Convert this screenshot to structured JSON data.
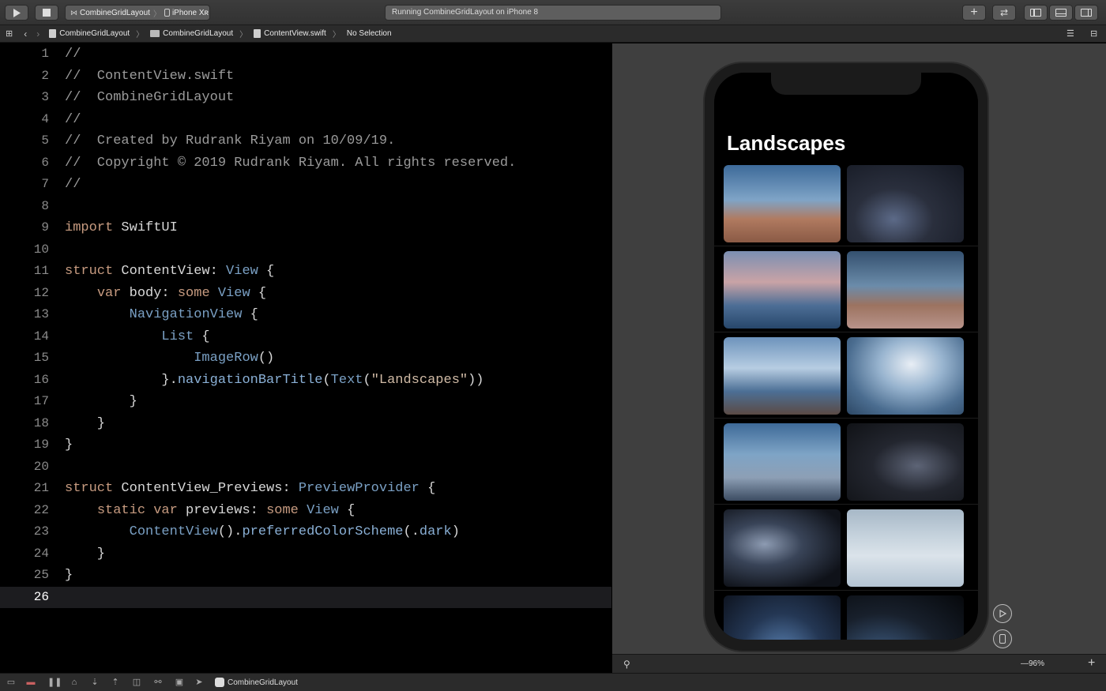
{
  "toolbar": {
    "scheme_project": "CombineGridLayout",
    "scheme_device": "iPhone Xʀ",
    "activity": "Running CombineGridLayout on iPhone 8",
    "add_label": "+",
    "swap_label": "⇄"
  },
  "jumpbar": {
    "project": "CombineGridLayout",
    "group": "CombineGridLayout",
    "file": "ContentView.swift",
    "selection": "No Selection"
  },
  "editor": {
    "current_line": 26,
    "lines": [
      "1",
      "2",
      "3",
      "4",
      "5",
      "6",
      "7",
      "8",
      "9",
      "10",
      "11",
      "12",
      "13",
      "14",
      "15",
      "16",
      "17",
      "18",
      "19",
      "20",
      "21",
      "22",
      "23",
      "24",
      "25",
      "26"
    ],
    "code": {
      "l1": "//",
      "l2": "//  ContentView.swift",
      "l3": "//  CombineGridLayout",
      "l4": "//",
      "l5": "//  Created by Rudrank Riyam on 10/09/19.",
      "l6": "//  Copyright © 2019 Rudrank Riyam. All rights reserved.",
      "l7": "//",
      "l9_kw": "import",
      "l9_rest": " SwiftUI",
      "l11_kw": "struct",
      "l11_name": " ContentView: ",
      "l11_type": "View",
      "l11_end": " {",
      "l12_indent": "    ",
      "l12_kw1": "var",
      "l12_name": " body: ",
      "l12_kw2": "some",
      "l12_sp": " ",
      "l12_type": "View",
      "l12_end": " {",
      "l13_indent": "        ",
      "l13_type": "NavigationView",
      "l13_end": " {",
      "l14_indent": "            ",
      "l14_type": "List",
      "l14_end": " {",
      "l15_indent": "                ",
      "l15_type": "ImageRow",
      "l15_end": "()",
      "l16_indent": "            }.",
      "l16_fn": "navigationBarTitle",
      "l16_p1": "(",
      "l16_type": "Text",
      "l16_p2": "(",
      "l16_str": "\"Landscapes\"",
      "l16_end": "))",
      "l17": "        }",
      "l18": "    }",
      "l19": "}",
      "l21_kw": "struct",
      "l21_name": " ContentView_Previews: ",
      "l21_type": "PreviewProvider",
      "l21_end": " {",
      "l22_indent": "    ",
      "l22_kw1": "static",
      "l22_sp": " ",
      "l22_kw2": "var",
      "l22_name": " previews: ",
      "l22_kw3": "some",
      "l22_sp2": " ",
      "l22_type": "View",
      "l22_end": " {",
      "l23_indent": "        ",
      "l23_type": "ContentView",
      "l23_p": "().",
      "l23_fn": "preferredColorScheme",
      "l23_p2": "(.",
      "l23_val": "dark",
      "l23_end": ")",
      "l24": "    }",
      "l25": "}"
    }
  },
  "preview": {
    "nav_title": "Landscapes",
    "zoom": "—96%",
    "zoom_plus": "+",
    "thumbnails": [
      {
        "name": "desert-arch"
      },
      {
        "name": "night-rover"
      },
      {
        "name": "pink-seashore"
      },
      {
        "name": "canyon-mesa"
      },
      {
        "name": "coastal-pine"
      },
      {
        "name": "sunlit-sea"
      },
      {
        "name": "lightning-road"
      },
      {
        "name": "dark-sky"
      },
      {
        "name": "storm-clouds"
      },
      {
        "name": "salt-flats"
      },
      {
        "name": "blue-glow"
      },
      {
        "name": "night-tree"
      }
    ]
  },
  "debugbar": {
    "target": "CombineGridLayout"
  },
  "colors": {
    "editor_bg": "#000000",
    "keyword": "#c79b80",
    "type": "#7aa0c4",
    "comment": "#9b9b9b",
    "string": "#d1bba6",
    "canvas_bg": "#3f3f3f"
  }
}
